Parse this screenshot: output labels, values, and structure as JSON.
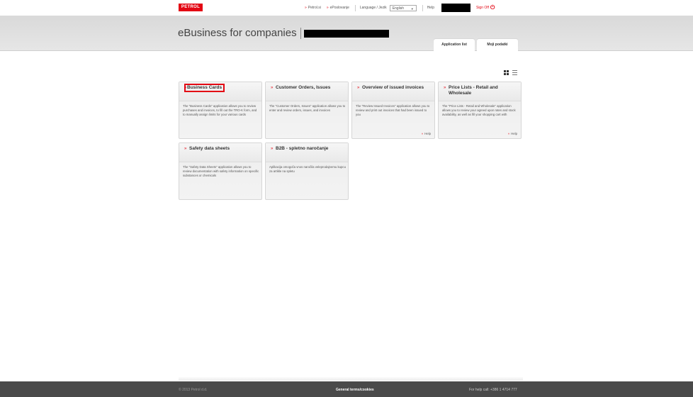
{
  "topbar": {
    "logo": "PETROL",
    "links": [
      "Petrol.si",
      "ePoslovanje"
    ],
    "language_label": "Language / Jezik",
    "language_value": "English",
    "help": "Help",
    "signoff": "Sign Off"
  },
  "header": {
    "title": "eBusiness for companies",
    "tabs": [
      "Application list",
      "Moji podatki"
    ]
  },
  "cards": [
    {
      "title": "Business Cards",
      "description": "The \"Business Cards\" application allows you to review purchases and invoices, to fill out the TRO-K form, and to manually assign limits for your various cards",
      "help": ""
    },
    {
      "title": "Customer Orders, Issues",
      "description": "The \"Customer Orders, Issues\" application allows you to enter and review orders, issues, and invoices",
      "help": ""
    },
    {
      "title": "Overview of issued invoices",
      "description": "The \"Review Issued Invoices\" application allows you to review and print out invoices that had been issued to you",
      "help": "Help"
    },
    {
      "title": "Price Lists - Retail and Wholesale",
      "description": "The \"Price Lists - Retail and Wholesale\" application allows you to review your agreed upon rates and stock availability, as well as fill your shopping cart with",
      "help": "Help"
    },
    {
      "title": "Safety data sheets",
      "description": "The \"Safety Data Sheets\" application allows you to review documentation with safety information on specific substances or chemicals",
      "help": ""
    },
    {
      "title": "B2B - spletno naročanje",
      "description": "Aplikacija omogoča vnos naročila veleprodajnemu kupcu za artikle na spletu",
      "help": ""
    }
  ],
  "footer": {
    "copyright": "© 2013 Petrol d.d.",
    "terms": "General terms/cookies",
    "help_call": "For help call: +386 1 4714 777"
  },
  "colors": {
    "brand_red": "#e30613",
    "header_gray": "#dedede",
    "footer_dark": "#4a4a4a"
  }
}
